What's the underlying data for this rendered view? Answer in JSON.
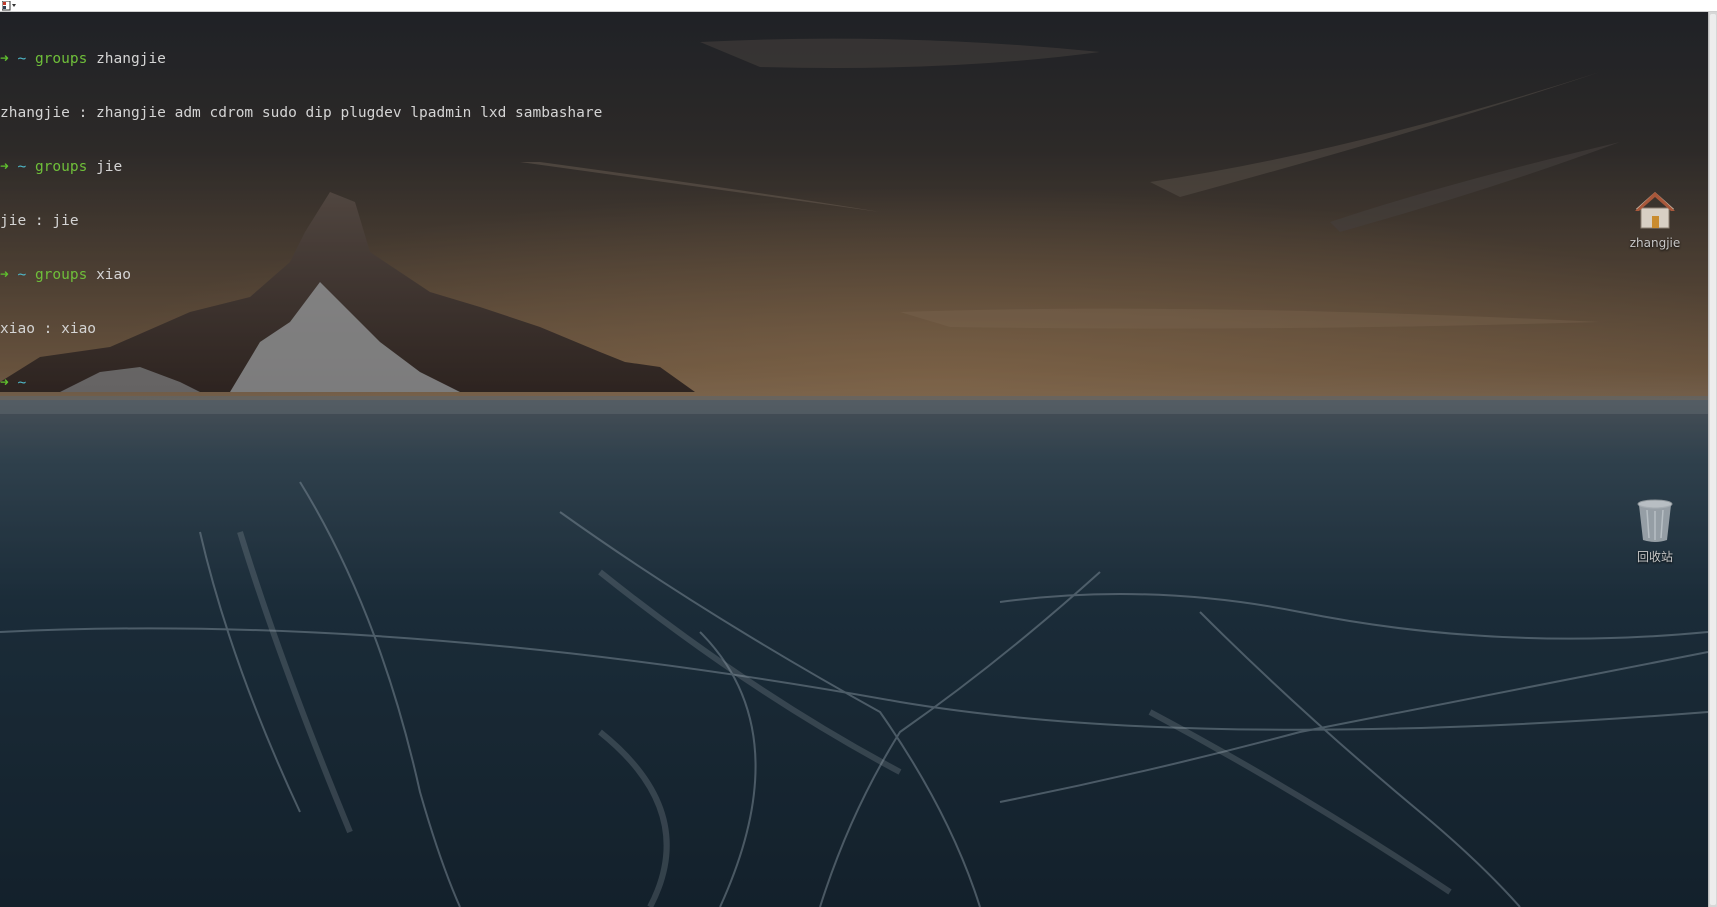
{
  "terminal": {
    "prompt_arrow": "➜",
    "prompt_dir": "~",
    "lines": [
      {
        "type": "prompt",
        "cmd": "groups",
        "arg": "zhangjie"
      },
      {
        "type": "output",
        "text": "zhangjie : zhangjie adm cdrom sudo dip plugdev lpadmin lxd sambashare"
      },
      {
        "type": "prompt",
        "cmd": "groups",
        "arg": "jie"
      },
      {
        "type": "output",
        "text": "jie : jie"
      },
      {
        "type": "prompt",
        "cmd": "groups",
        "arg": "xiao"
      },
      {
        "type": "output",
        "text": "xiao : xiao"
      },
      {
        "type": "prompt",
        "cmd": "",
        "arg": ""
      }
    ]
  },
  "desktop_icons": {
    "home": {
      "label": "zhangjie",
      "icon": "home-folder-icon"
    },
    "trash": {
      "label": "回收站",
      "icon": "trash-icon"
    }
  },
  "colors": {
    "prompt_arrow": "#5fbf2e",
    "prompt_dir": "#4fb8c9",
    "command": "#6fbf3a",
    "output": "#d4d4d4"
  }
}
